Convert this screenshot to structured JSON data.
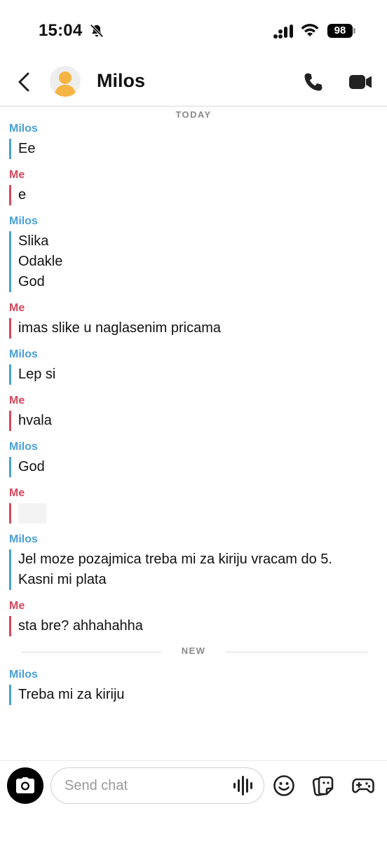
{
  "status_bar": {
    "time": "15:04",
    "battery": "98",
    "icons": [
      "bell-slash-icon",
      "signal-icon",
      "wifi-icon",
      "battery-icon"
    ]
  },
  "header": {
    "contact_name": "Milos",
    "icons": [
      "back-icon",
      "avatar",
      "call-icon",
      "video-icon"
    ]
  },
  "chat": {
    "today_label": "TODAY",
    "new_label": "NEW",
    "groups": [
      {
        "sender": "Milos",
        "lines": [
          "Ee"
        ]
      },
      {
        "sender": "Me",
        "lines": [
          "e"
        ]
      },
      {
        "sender": "Milos",
        "lines": [
          "Slika",
          "Odakle",
          "God"
        ]
      },
      {
        "sender": "Me",
        "lines": [
          "imas slike u naglasenim pricama"
        ]
      },
      {
        "sender": "Milos",
        "lines": [
          "Lep si"
        ]
      },
      {
        "sender": "Me",
        "lines": [
          "hvala"
        ]
      },
      {
        "sender": "Milos",
        "lines": [
          "God"
        ]
      },
      {
        "sender": "Me",
        "lines": []
      },
      {
        "sender": "Milos",
        "lines": [
          "Jel moze pozajmica treba mi za kiriju vracam do 5.",
          "Kasni mi plata"
        ]
      },
      {
        "sender": "Me",
        "lines": [
          "sta bre? ahhahahha"
        ]
      },
      {
        "sender": "Milos",
        "lines": [
          "Treba mi za kiriju"
        ]
      }
    ]
  },
  "composer": {
    "placeholder": "Send chat",
    "icons": [
      "camera-icon",
      "voice-icon",
      "emoji-icon",
      "sticker-icon",
      "game-icon"
    ]
  },
  "colors": {
    "milos": "#4a9fd8",
    "me": "#d24a5e"
  }
}
